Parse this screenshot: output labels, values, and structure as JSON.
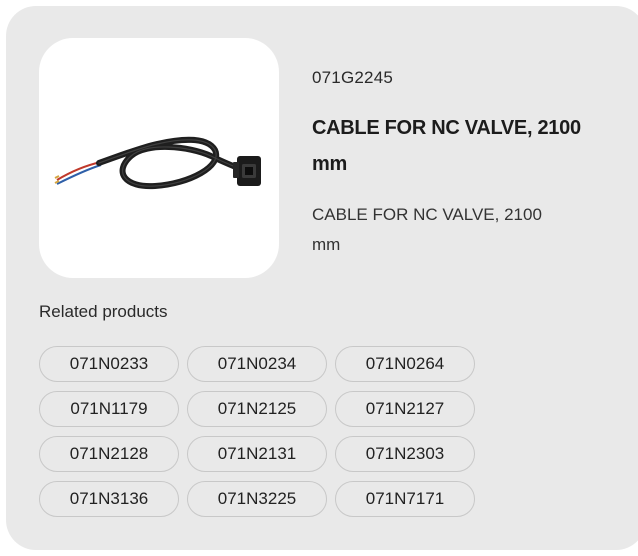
{
  "product": {
    "sku": "071G2245",
    "title": "CABLE FOR NC VALVE, 2100 mm",
    "description": "CABLE FOR NC VALVE, 2100 mm",
    "image_icon": "cable-with-connector-icon"
  },
  "related": {
    "label": "Related products",
    "items": [
      "071N0233",
      "071N0234",
      "071N0264",
      "071N1179",
      "071N2125",
      "071N2127",
      "071N2128",
      "071N2131",
      "071N2303",
      "071N3136",
      "071N3225",
      "071N7171"
    ]
  },
  "colors": {
    "card_background": "#e9e9e9",
    "chip_border": "#c8c8c8",
    "text": "#222222"
  }
}
